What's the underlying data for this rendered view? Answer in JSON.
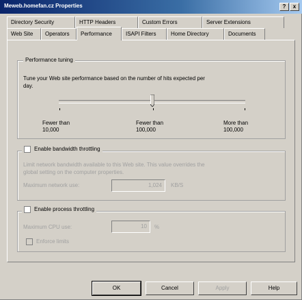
{
  "window": {
    "title": "Meweb.homefan.cz Properties",
    "help_button": "?",
    "close_button": "x"
  },
  "tabs": {
    "row1": [
      "Directory Security",
      "HTTP Headers",
      "Custom Errors",
      "Server Extensions"
    ],
    "row2": [
      "Web Site",
      "Operators",
      "Performance",
      "ISAPI Filters",
      "Home Directory",
      "Documents"
    ],
    "selected": "Performance"
  },
  "performance_tuning": {
    "legend": "Performance tuning",
    "description_line1": "Tune your Web site performance based on the number of hits expected per",
    "description_line2": "day.",
    "slider_position": 0.5,
    "labels": [
      {
        "line1": "Fewer than",
        "line2": "10,000"
      },
      {
        "line1": "Fewer than",
        "line2": "100,000"
      },
      {
        "line1": "More than",
        "line2": "100,000"
      }
    ]
  },
  "bandwidth": {
    "checkbox_label": "Enable bandwidth throttling",
    "checked": false,
    "description_line1": "Limit network bandwidth available to this Web site. This value overrides the",
    "description_line2": "global setting on the computer properties.",
    "max_label": "Maximum network use:",
    "max_value": "1,024",
    "unit": "KB/S"
  },
  "process": {
    "checkbox_label": "Enable process throttling",
    "checked": false,
    "cpu_label": "Maximum CPU use:",
    "cpu_value": "10",
    "cpu_unit": "%",
    "enforce_label": "Enforce limits"
  },
  "buttons": {
    "ok": "OK",
    "cancel": "Cancel",
    "apply": "Apply",
    "help": "Help"
  }
}
